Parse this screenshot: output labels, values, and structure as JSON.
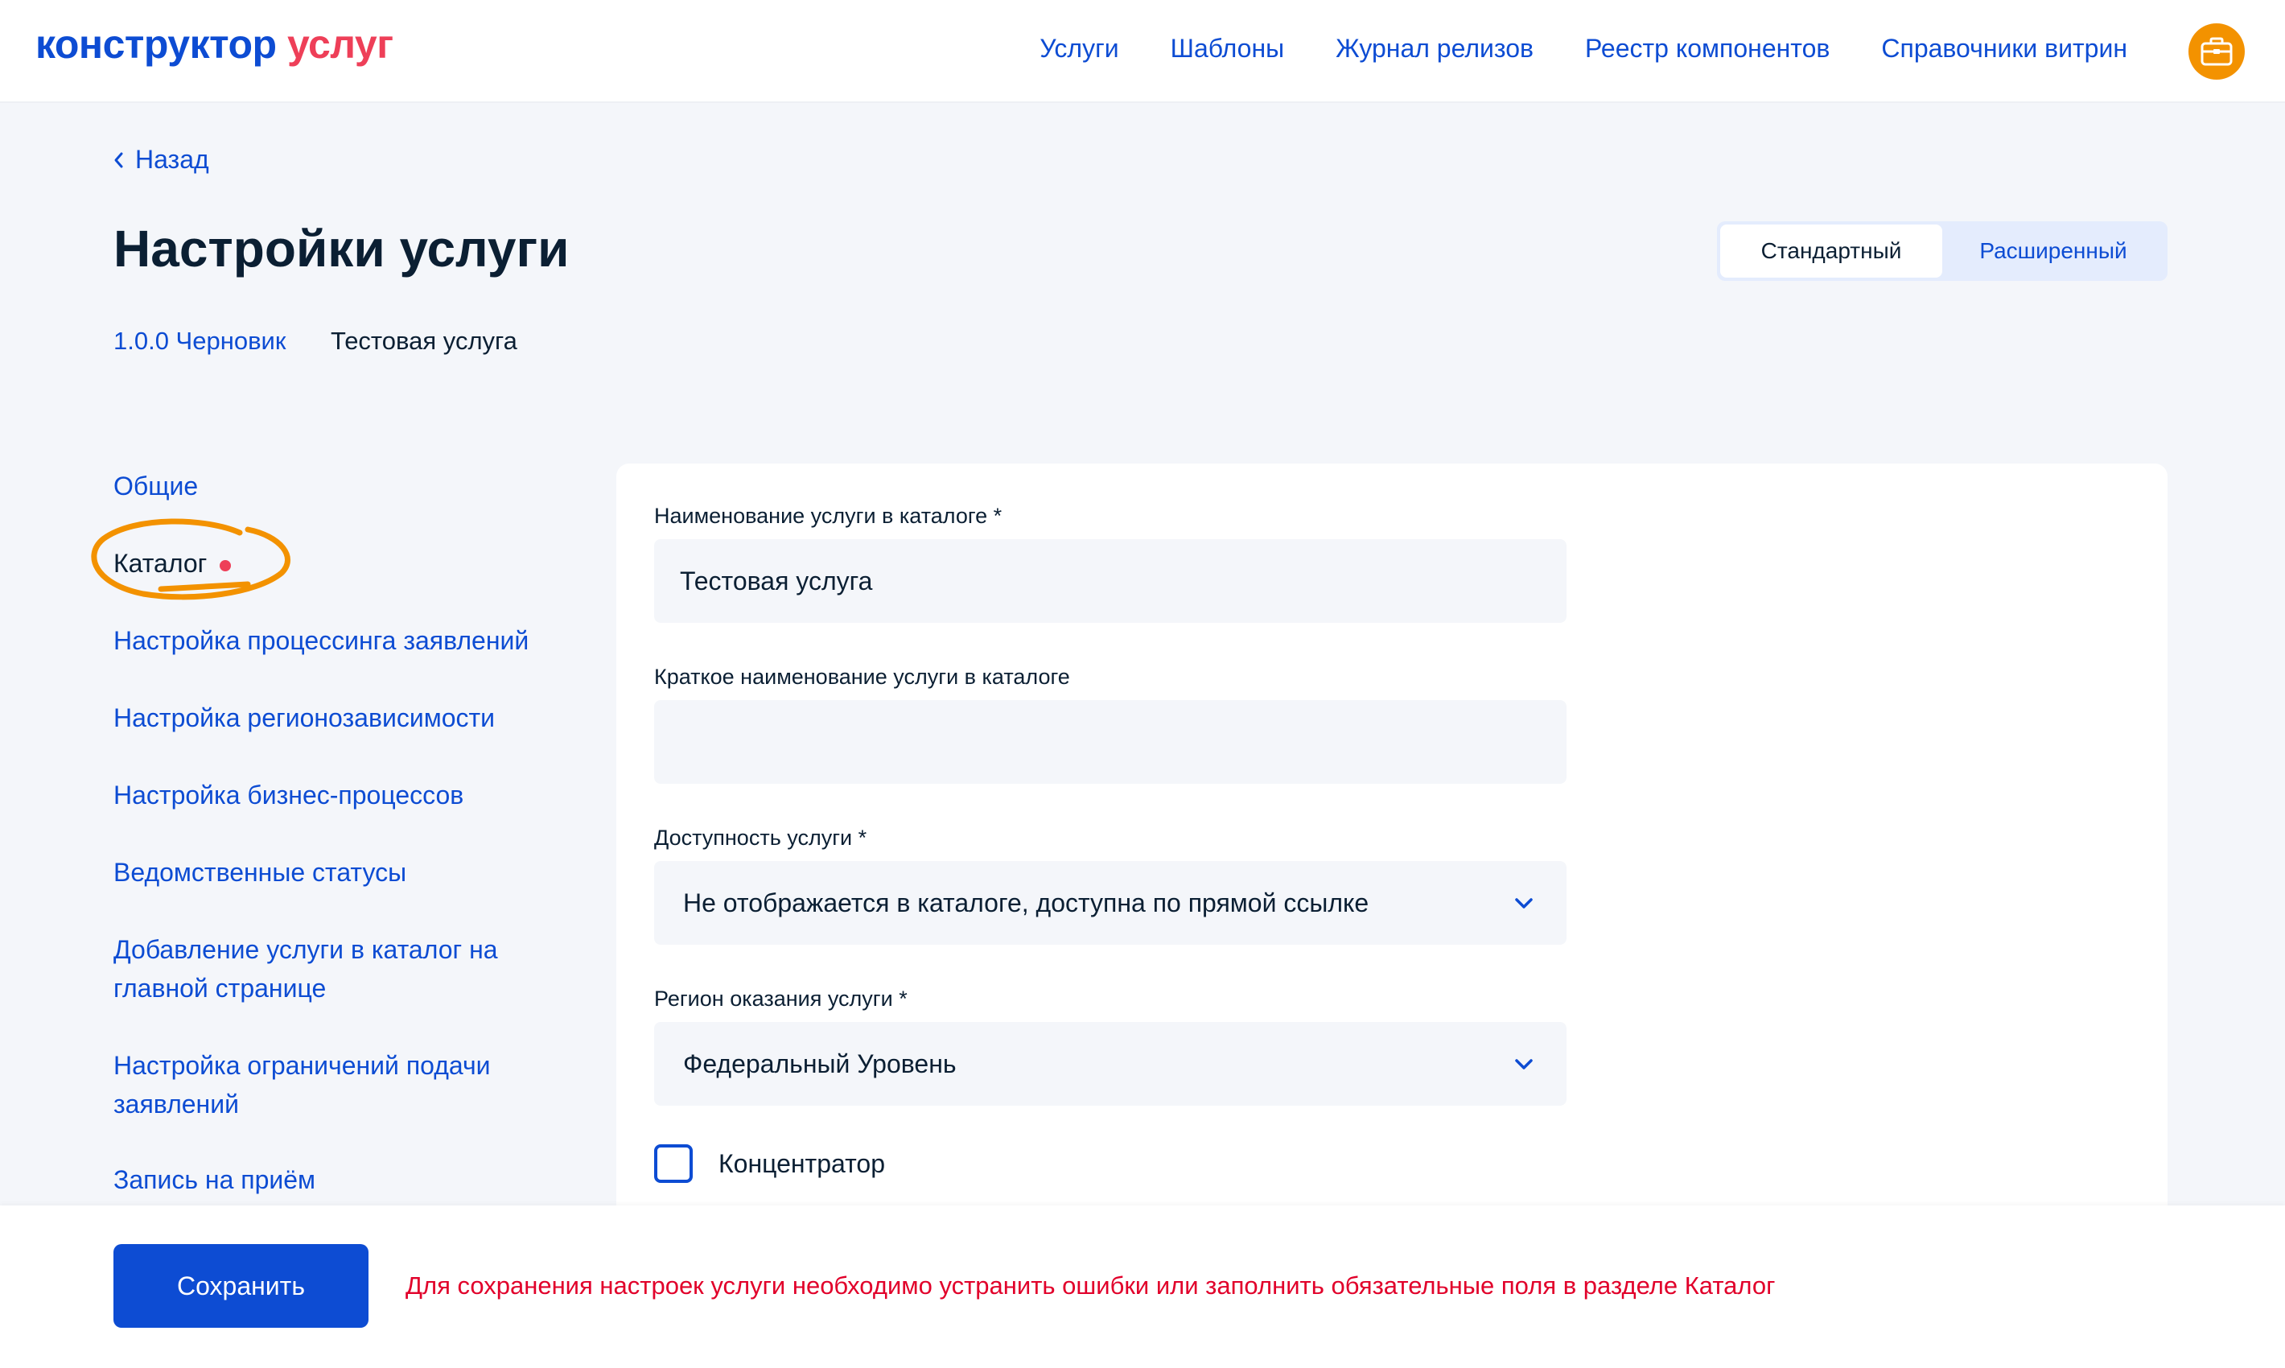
{
  "header": {
    "logo_part1": "конструктор",
    "logo_part2": "услуг",
    "nav": [
      "Услуги",
      "Шаблоны",
      "Журнал релизов",
      "Реестр компонентов",
      "Справочники витрин"
    ],
    "avatar_icon": "briefcase-icon"
  },
  "back_label": "Назад",
  "page_title": "Настройки услуги",
  "mode_switch": {
    "standard": "Стандартный",
    "extended": "Расширенный",
    "active": "standard"
  },
  "version": "1.0.0 Черновик",
  "service_name": "Тестовая услуга",
  "sidebar": {
    "items": [
      "Общие",
      "Каталог",
      "Настройка процессинга заявлений",
      "Настройка регионозависимости",
      "Настройка бизнес-процессов",
      "Ведомственные статусы",
      "Добавление услуги в каталог на главной странице",
      "Настройка ограничений подачи заявлений",
      "Запись на приём"
    ],
    "active_index": 1
  },
  "form": {
    "name_label": "Наименование услуги в каталоге *",
    "name_value": "Тестовая услуга",
    "short_name_label": "Краткое наименование услуги в каталоге",
    "short_name_value": "",
    "availability_label": "Доступность услуги *",
    "availability_value": "Не отображается в каталоге, доступна по прямой ссылке",
    "region_label": "Регион оказания услуги *",
    "region_value": "Федеральный Уровень",
    "concentrator_label": "Концентратор"
  },
  "footer": {
    "save_label": "Сохранить",
    "error_message": "Для сохранения настроек услуги необходимо устранить ошибки или заполнить обязательные поля в разделе Каталог"
  },
  "colors": {
    "accent": "#0d4cd3",
    "brand_red": "#ee3f58",
    "highlight_orange": "#f39200",
    "error_text": "#e1002a"
  }
}
